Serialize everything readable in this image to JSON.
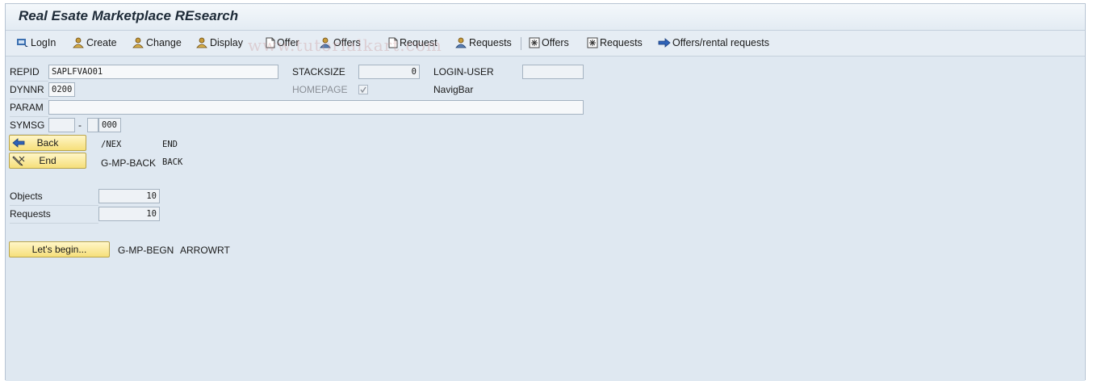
{
  "window": {
    "title": "Real Esate Marketplace REsearch"
  },
  "toolbar": {
    "items": [
      {
        "label": "LogIn",
        "icon": "login-icon"
      },
      {
        "label": "Create",
        "icon": "person-create-icon"
      },
      {
        "label": "Change",
        "icon": "person-change-icon"
      },
      {
        "label": "Display",
        "icon": "person-display-icon"
      },
      {
        "label": "Offer",
        "icon": "document-icon"
      },
      {
        "label": "Offers",
        "icon": "person-offers-icon"
      },
      {
        "label": "Request",
        "icon": "document-request-icon"
      },
      {
        "label": "Requests",
        "icon": "person-requests-icon"
      },
      {
        "label": "Offers",
        "icon": "star-box-icon"
      },
      {
        "label": "Requests",
        "icon": "star-box-icon"
      },
      {
        "label": "Offers/rental requests",
        "icon": "arrow-right-icon"
      }
    ]
  },
  "watermark": "www.tutorialkart.com",
  "form": {
    "repid": {
      "label": "REPID",
      "value": "SAPLFVAO01"
    },
    "stacksize": {
      "label": "STACKSIZE",
      "value": "0"
    },
    "login_user": {
      "label": "LOGIN-USER",
      "value": ""
    },
    "dynnr": {
      "label": "DYNNR",
      "value": "0200"
    },
    "homepage": {
      "label": "HOMEPAGE",
      "checked": true
    },
    "navigbar": {
      "label": "NavigBar"
    },
    "param": {
      "label": "PARAM",
      "value": ""
    },
    "symsg": {
      "label": "SYMSG",
      "value1": "",
      "dash": "-",
      "value2": "",
      "value3": "000"
    }
  },
  "buttons": {
    "back": {
      "label": "Back",
      "code1": "/NEX",
      "code2": "END",
      "icon": "arrow-left-icon"
    },
    "end": {
      "label": "End",
      "code1": "G-MP-BACK",
      "code2": "BACK",
      "icon": "pencil-cancel-icon"
    },
    "begin": {
      "label": "Let's begin...",
      "code1": "G-MP-BEGN",
      "code2": "ARROWRT"
    }
  },
  "counts": {
    "objects": {
      "label": "Objects",
      "value": "10"
    },
    "requests": {
      "label": "Requests",
      "value": "10"
    }
  },
  "colors": {
    "accent": "#f6df7a",
    "background": "#dfe8f1"
  }
}
